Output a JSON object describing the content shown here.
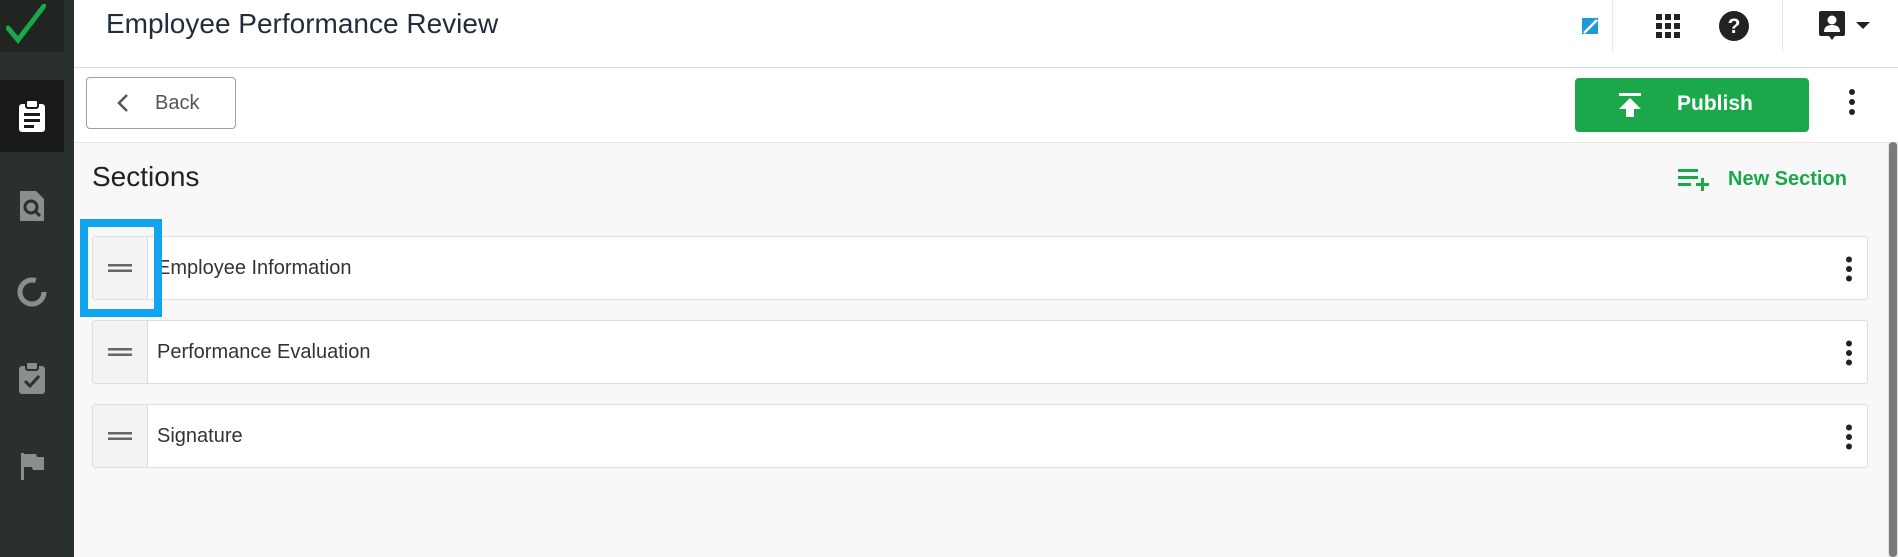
{
  "header": {
    "title": "Employee Performance Review"
  },
  "toolbar": {
    "back_label": "Back",
    "publish_label": "Publish"
  },
  "sections": {
    "heading": "Sections",
    "new_section_label": "New Section",
    "items": [
      {
        "label": "Employee Information"
      },
      {
        "label": "Performance Evaluation"
      },
      {
        "label": "Signature"
      }
    ]
  },
  "icons": {
    "sidebar": [
      "clipboard-icon",
      "document-search-icon",
      "circle-progress-icon",
      "clipboard-check-icon",
      "flag-icon"
    ],
    "header": [
      "zendesk-icon",
      "apps-grid-icon",
      "help-icon",
      "account-icon",
      "caret-down-icon"
    ]
  },
  "colors": {
    "brand_green": "#1aa84b",
    "sidebar_bg": "#2a302c",
    "highlight": "#11a5ef"
  }
}
